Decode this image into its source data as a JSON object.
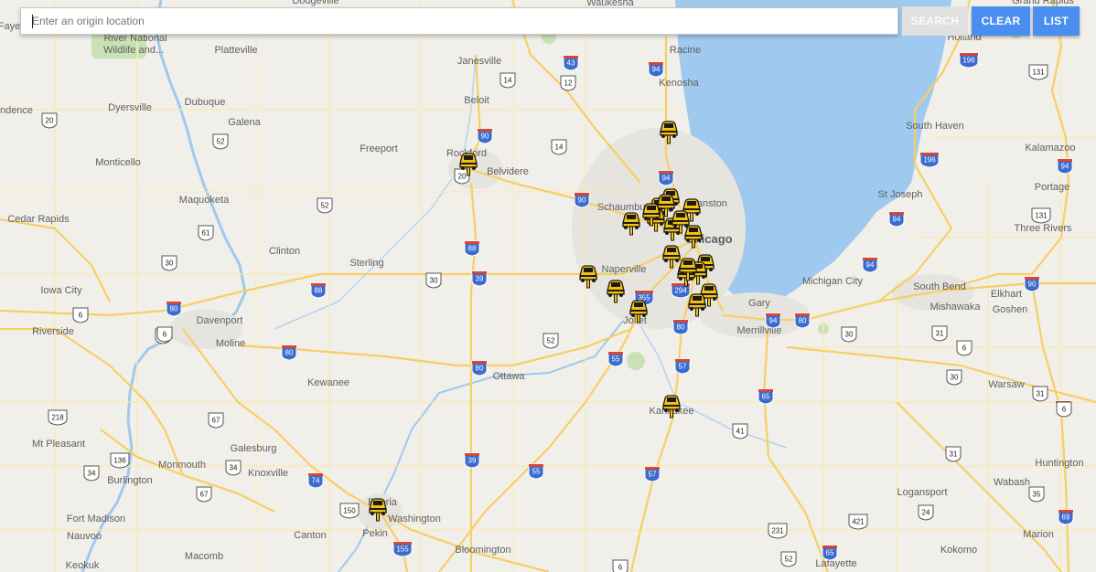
{
  "search": {
    "placeholder": "Enter an origin location",
    "value": ""
  },
  "buttons": {
    "search": "SEARCH",
    "clear": "CLEAR",
    "list": "LIST"
  },
  "colors": {
    "water": "#9fc9ee",
    "land": "#f1efe9",
    "highway": "#fbd97c",
    "interstate_shield": "#3a6bcf",
    "park": "#c8e2b5",
    "button": "#4a8ef0",
    "marker": "#f4c20d"
  },
  "map": {
    "labels": [
      {
        "id": "chicago",
        "text": "Chicago",
        "major": true
      },
      {
        "id": "naperville",
        "text": "Naperville"
      },
      {
        "id": "schaumburg",
        "text": "Schaumburg"
      },
      {
        "id": "evanston",
        "text": "Evanston"
      },
      {
        "id": "joliet",
        "text": "Joliet"
      },
      {
        "id": "gary",
        "text": "Gary"
      },
      {
        "id": "merrillville",
        "text": "Merrillville"
      },
      {
        "id": "rockford",
        "text": "Rockford"
      },
      {
        "id": "belvidere",
        "text": "Belvidere"
      },
      {
        "id": "freeport",
        "text": "Freeport"
      },
      {
        "id": "janesville",
        "text": "Janesville"
      },
      {
        "id": "beloit",
        "text": "Beloit"
      },
      {
        "id": "racine",
        "text": "Racine"
      },
      {
        "id": "kenosha",
        "text": "Kenosha"
      },
      {
        "id": "waukesha",
        "text": "Waukesha"
      },
      {
        "id": "dodgeville",
        "text": "Dodgeville"
      },
      {
        "id": "platteville",
        "text": "Platteville"
      },
      {
        "id": "dubuque",
        "text": "Dubuque"
      },
      {
        "id": "galena",
        "text": "Galena"
      },
      {
        "id": "dyersville",
        "text": "Dyersville"
      },
      {
        "id": "monticello",
        "text": "Monticello"
      },
      {
        "id": "maquoketa",
        "text": "Maquoketa"
      },
      {
        "id": "cedar_rapids",
        "text": "Cedar Rapids"
      },
      {
        "id": "iowa_city",
        "text": "Iowa City"
      },
      {
        "id": "clinton",
        "text": "Clinton"
      },
      {
        "id": "sterling",
        "text": "Sterling"
      },
      {
        "id": "davenport",
        "text": "Davenport"
      },
      {
        "id": "moline",
        "text": "Moline"
      },
      {
        "id": "riverside",
        "text": "Riverside"
      },
      {
        "id": "kewanee",
        "text": "Kewanee"
      },
      {
        "id": "ottawa",
        "text": "Ottawa"
      },
      {
        "id": "kankakee",
        "text": "Kankakee"
      },
      {
        "id": "galesburg",
        "text": "Galesburg"
      },
      {
        "id": "monmouth",
        "text": "Monmouth"
      },
      {
        "id": "knoxville",
        "text": "Knoxville"
      },
      {
        "id": "mt_pleasant",
        "text": "Mt Pleasant"
      },
      {
        "id": "burlington",
        "text": "Burlington"
      },
      {
        "id": "fort_madison",
        "text": "Fort Madison"
      },
      {
        "id": "nauvoo",
        "text": "Nauvoo"
      },
      {
        "id": "keokuk",
        "text": "Keokuk"
      },
      {
        "id": "macomb",
        "text": "Macomb"
      },
      {
        "id": "canton",
        "text": "Canton"
      },
      {
        "id": "peoria",
        "text": "Peoria"
      },
      {
        "id": "washington",
        "text": "Washington"
      },
      {
        "id": "pekin",
        "text": "Pekin"
      },
      {
        "id": "bloomington",
        "text": "Bloomington"
      },
      {
        "id": "holland",
        "text": "Holland"
      },
      {
        "id": "grand_rapids",
        "text": "Grand Rapids"
      },
      {
        "id": "south_haven",
        "text": "South Haven"
      },
      {
        "id": "kalamazoo",
        "text": "Kalamazoo"
      },
      {
        "id": "portage",
        "text": "Portage"
      },
      {
        "id": "st_joseph",
        "text": "St Joseph"
      },
      {
        "id": "three_rivers",
        "text": "Three Rivers"
      },
      {
        "id": "michigan_city",
        "text": "Michigan City"
      },
      {
        "id": "south_bend",
        "text": "South Bend"
      },
      {
        "id": "mishawaka",
        "text": "Mishawaka"
      },
      {
        "id": "elkhart",
        "text": "Elkhart"
      },
      {
        "id": "goshen",
        "text": "Goshen"
      },
      {
        "id": "warsaw",
        "text": "Warsaw"
      },
      {
        "id": "wabash",
        "text": "Wabash"
      },
      {
        "id": "huntington",
        "text": "Huntington"
      },
      {
        "id": "logansport",
        "text": "Logansport"
      },
      {
        "id": "marion",
        "text": "Marion"
      },
      {
        "id": "kokomo",
        "text": "Kokomo"
      },
      {
        "id": "lafayette",
        "text": "Lafayette"
      },
      {
        "id": "independence",
        "text": "ndence"
      },
      {
        "id": "fayette",
        "text": "Faye"
      },
      {
        "id": "river_national",
        "text": "River National"
      },
      {
        "id": "wildlife",
        "text": "Wildlife and..."
      }
    ],
    "shields": [
      {
        "id": "i43",
        "num": "43",
        "type": "interstate"
      },
      {
        "id": "i94a",
        "num": "94",
        "type": "interstate"
      },
      {
        "id": "i94b",
        "num": "94",
        "type": "interstate"
      },
      {
        "id": "i90a",
        "num": "90",
        "type": "interstate"
      },
      {
        "id": "i90b",
        "num": "90",
        "type": "interstate"
      },
      {
        "id": "i88",
        "num": "88",
        "type": "interstate"
      },
      {
        "id": "i39a",
        "num": "39",
        "type": "interstate"
      },
      {
        "id": "i39b",
        "num": "39",
        "type": "interstate"
      },
      {
        "id": "i80a",
        "num": "80",
        "type": "interstate"
      },
      {
        "id": "i80b",
        "num": "80",
        "type": "interstate"
      },
      {
        "id": "i80c",
        "num": "80",
        "type": "interstate"
      },
      {
        "id": "i80d",
        "num": "80",
        "type": "interstate"
      },
      {
        "id": "i80e",
        "num": "80",
        "type": "interstate"
      },
      {
        "id": "i55a",
        "num": "55",
        "type": "interstate"
      },
      {
        "id": "i55b",
        "num": "55",
        "type": "interstate"
      },
      {
        "id": "i57a",
        "num": "57",
        "type": "interstate"
      },
      {
        "id": "i57b",
        "num": "57",
        "type": "interstate"
      },
      {
        "id": "i74",
        "num": "74",
        "type": "interstate"
      },
      {
        "id": "i155",
        "num": "155",
        "type": "interstate"
      },
      {
        "id": "i65a",
        "num": "65",
        "type": "interstate"
      },
      {
        "id": "i65b",
        "num": "65",
        "type": "interstate"
      },
      {
        "id": "i294",
        "num": "294",
        "type": "interstate"
      },
      {
        "id": "i355",
        "num": "355",
        "type": "interstate"
      },
      {
        "id": "i196a",
        "num": "196",
        "type": "interstate"
      },
      {
        "id": "i196b",
        "num": "196",
        "type": "interstate"
      },
      {
        "id": "i94c",
        "num": "94",
        "type": "interstate"
      },
      {
        "id": "i94d",
        "num": "94",
        "type": "interstate"
      },
      {
        "id": "i94e",
        "num": "94",
        "type": "interstate"
      },
      {
        "id": "i94f",
        "num": "94",
        "type": "interstate"
      },
      {
        "id": "i90c",
        "num": "90",
        "type": "interstate"
      },
      {
        "id": "i90d",
        "num": "90",
        "type": "interstate"
      },
      {
        "id": "i69",
        "num": "69",
        "type": "interstate"
      },
      {
        "id": "i88b",
        "num": "88",
        "type": "interstate"
      },
      {
        "id": "us14a",
        "num": "14",
        "type": "us"
      },
      {
        "id": "us14b",
        "num": "14",
        "type": "us"
      },
      {
        "id": "us12",
        "num": "12",
        "type": "us"
      },
      {
        "id": "us20a",
        "num": "20",
        "type": "us"
      },
      {
        "id": "us20b",
        "num": "20",
        "type": "us"
      },
      {
        "id": "us52a",
        "num": "52",
        "type": "us"
      },
      {
        "id": "us52b",
        "num": "52",
        "type": "us"
      },
      {
        "id": "us52c",
        "num": "52",
        "type": "us"
      },
      {
        "id": "us52d",
        "num": "52",
        "type": "us"
      },
      {
        "id": "us61a",
        "num": "61",
        "type": "us"
      },
      {
        "id": "us61b",
        "num": "61",
        "type": "us"
      },
      {
        "id": "us30a",
        "num": "30",
        "type": "us"
      },
      {
        "id": "us30b",
        "num": "30",
        "type": "us"
      },
      {
        "id": "us30c",
        "num": "30",
        "type": "us"
      },
      {
        "id": "us6a",
        "num": "6",
        "type": "us"
      },
      {
        "id": "us6b",
        "num": "6",
        "type": "us"
      },
      {
        "id": "us6c",
        "num": "6",
        "type": "us"
      },
      {
        "id": "us6d",
        "num": "6",
        "type": "us"
      },
      {
        "id": "us67a",
        "num": "67",
        "type": "us"
      },
      {
        "id": "us67b",
        "num": "67",
        "type": "us"
      },
      {
        "id": "us34a",
        "num": "34",
        "type": "us"
      },
      {
        "id": "us34b",
        "num": "34",
        "type": "us"
      },
      {
        "id": "us150",
        "num": "150",
        "type": "us"
      },
      {
        "id": "us218",
        "num": "218",
        "type": "us"
      },
      {
        "id": "us136",
        "num": "136",
        "type": "us"
      },
      {
        "id": "us41",
        "num": "41",
        "type": "us"
      },
      {
        "id": "us31a",
        "num": "31",
        "type": "us"
      },
      {
        "id": "us31b",
        "num": "31",
        "type": "us"
      },
      {
        "id": "us31c",
        "num": "31",
        "type": "us"
      },
      {
        "id": "us31d",
        "num": "31",
        "type": "us"
      },
      {
        "id": "us131a",
        "num": "131",
        "type": "us"
      },
      {
        "id": "us131b",
        "num": "131",
        "type": "us"
      },
      {
        "id": "us35",
        "num": "35",
        "type": "us"
      },
      {
        "id": "us421",
        "num": "421",
        "type": "us"
      },
      {
        "id": "us24",
        "num": "24",
        "type": "us"
      },
      {
        "id": "us231",
        "num": "231",
        "type": "us"
      },
      {
        "id": "us6e",
        "num": "6",
        "type": "us"
      },
      {
        "id": "us30d",
        "num": "30",
        "type": "us"
      }
    ],
    "markers": [
      {
        "id": "m1"
      },
      {
        "id": "m2"
      },
      {
        "id": "m3"
      },
      {
        "id": "m4"
      },
      {
        "id": "m5"
      },
      {
        "id": "m6"
      },
      {
        "id": "m7"
      },
      {
        "id": "m8"
      },
      {
        "id": "m9"
      },
      {
        "id": "m10"
      },
      {
        "id": "m11"
      },
      {
        "id": "m12"
      },
      {
        "id": "m13"
      },
      {
        "id": "m14"
      },
      {
        "id": "m15"
      },
      {
        "id": "m16"
      },
      {
        "id": "m17"
      },
      {
        "id": "m18"
      },
      {
        "id": "m19"
      },
      {
        "id": "m20"
      },
      {
        "id": "m21"
      },
      {
        "id": "m22"
      },
      {
        "id": "m23"
      },
      {
        "id": "m24"
      }
    ]
  }
}
